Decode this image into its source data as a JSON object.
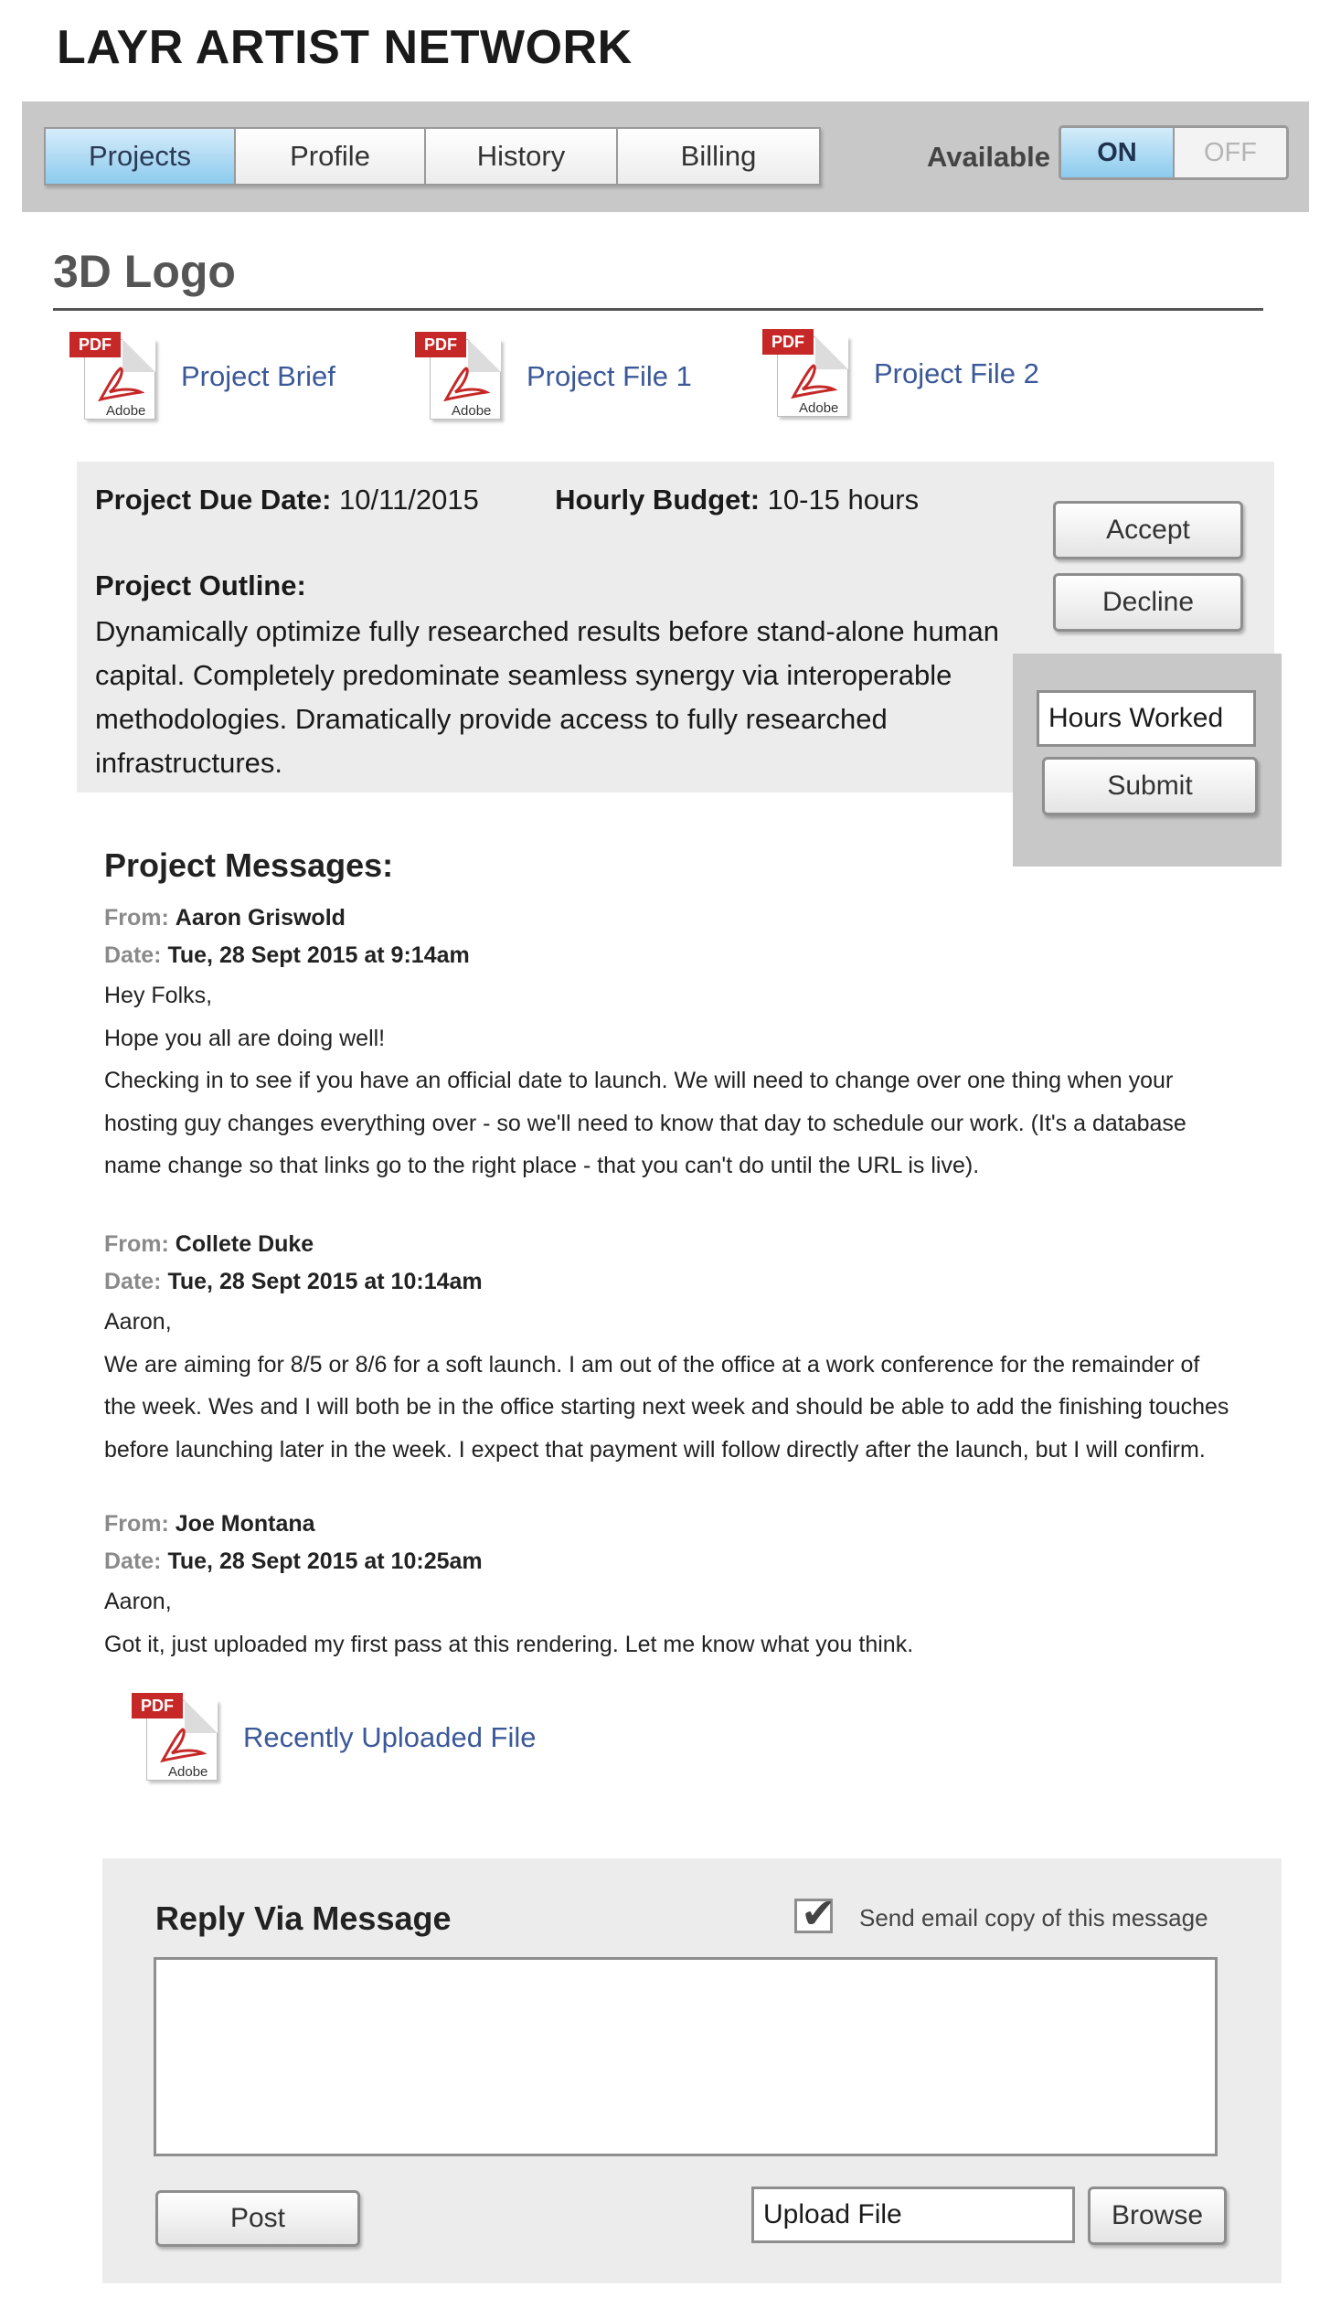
{
  "app": {
    "title": "LAYR ARTIST NETWORK"
  },
  "nav": {
    "tabs": [
      {
        "label": "Projects",
        "active": true
      },
      {
        "label": "Profile",
        "active": false
      },
      {
        "label": "History",
        "active": false
      },
      {
        "label": "Billing",
        "active": false
      }
    ],
    "availability": {
      "label": "Available",
      "on_label": "ON",
      "off_label": "OFF",
      "state": "ON"
    }
  },
  "project": {
    "title": "3D Logo",
    "files": [
      {
        "name": "Project Brief",
        "icon": "pdf-icon",
        "badge": "PDF",
        "brand": "Adobe"
      },
      {
        "name": "Project File 1",
        "icon": "pdf-icon",
        "badge": "PDF",
        "brand": "Adobe"
      },
      {
        "name": "Project File 2",
        "icon": "pdf-icon",
        "badge": "PDF",
        "brand": "Adobe"
      }
    ],
    "due_date_label": "Project Due Date:",
    "due_date": "10/11/2015",
    "budget_label": "Hourly Budget:",
    "budget": "10-15 hours",
    "outline_label": "Project Outline:",
    "outline": "Dynamically optimize fully researched results before stand-alone human capital. Completely predominate seamless synergy via interoperable methodologies. Dramatically provide access to fully researched infrastructures."
  },
  "actions": {
    "accept_label": "Accept",
    "decline_label": "Decline",
    "hours_placeholder": "Hours Worked",
    "submit_label": "Submit"
  },
  "messages": {
    "heading": "Project Messages:",
    "from_label": "From:",
    "date_label": "Date:",
    "items": [
      {
        "from": "Aaron Griswold",
        "date": "Tue, 28 Sept 2015 at 9:14am",
        "lines": [
          "Hey Folks,",
          "Hope you all are doing well!",
          "Checking in to see if you have an official date to launch. We will need to change over one thing when your",
          "hosting guy changes everything over - so we'll need to know that day to schedule our work. (It's a database",
          "name change so that links go to the right place - that you can't do until the URL is live)."
        ]
      },
      {
        "from": "Collete Duke",
        "date": "Tue, 28 Sept 2015 at 10:14am",
        "lines": [
          "Aaron,",
          "We are aiming for 8/5 or 8/6 for a soft launch. I am out of the office at a work conference for the remainder of",
          "the week. Wes and I will both be in the office starting next week and should be able to add the finishing touches",
          "before launching later in the week. I expect that payment will follow directly after the launch, but I will confirm."
        ]
      },
      {
        "from": "Joe Montana",
        "date": "Tue, 28 Sept 2015 at 10:25am",
        "lines": [
          "Aaron,",
          "Got it, just uploaded my first pass at this rendering. Let me know what you think."
        ],
        "attachment": {
          "name": "Recently Uploaded File",
          "icon": "pdf-icon",
          "badge": "PDF",
          "brand": "Adobe"
        }
      }
    ]
  },
  "reply": {
    "title": "Reply Via Message",
    "email_copy_label": "Send email copy of this message",
    "email_copy_checked": true,
    "message_value": "",
    "post_label": "Post",
    "upload_placeholder": "Upload File",
    "browse_label": "Browse"
  },
  "colors": {
    "active_tab": "#8ccbee",
    "link": "#3b5998",
    "pdf_badge": "#c62828",
    "panel_bg": "#ececec",
    "nav_bg": "#c8c8c8"
  }
}
